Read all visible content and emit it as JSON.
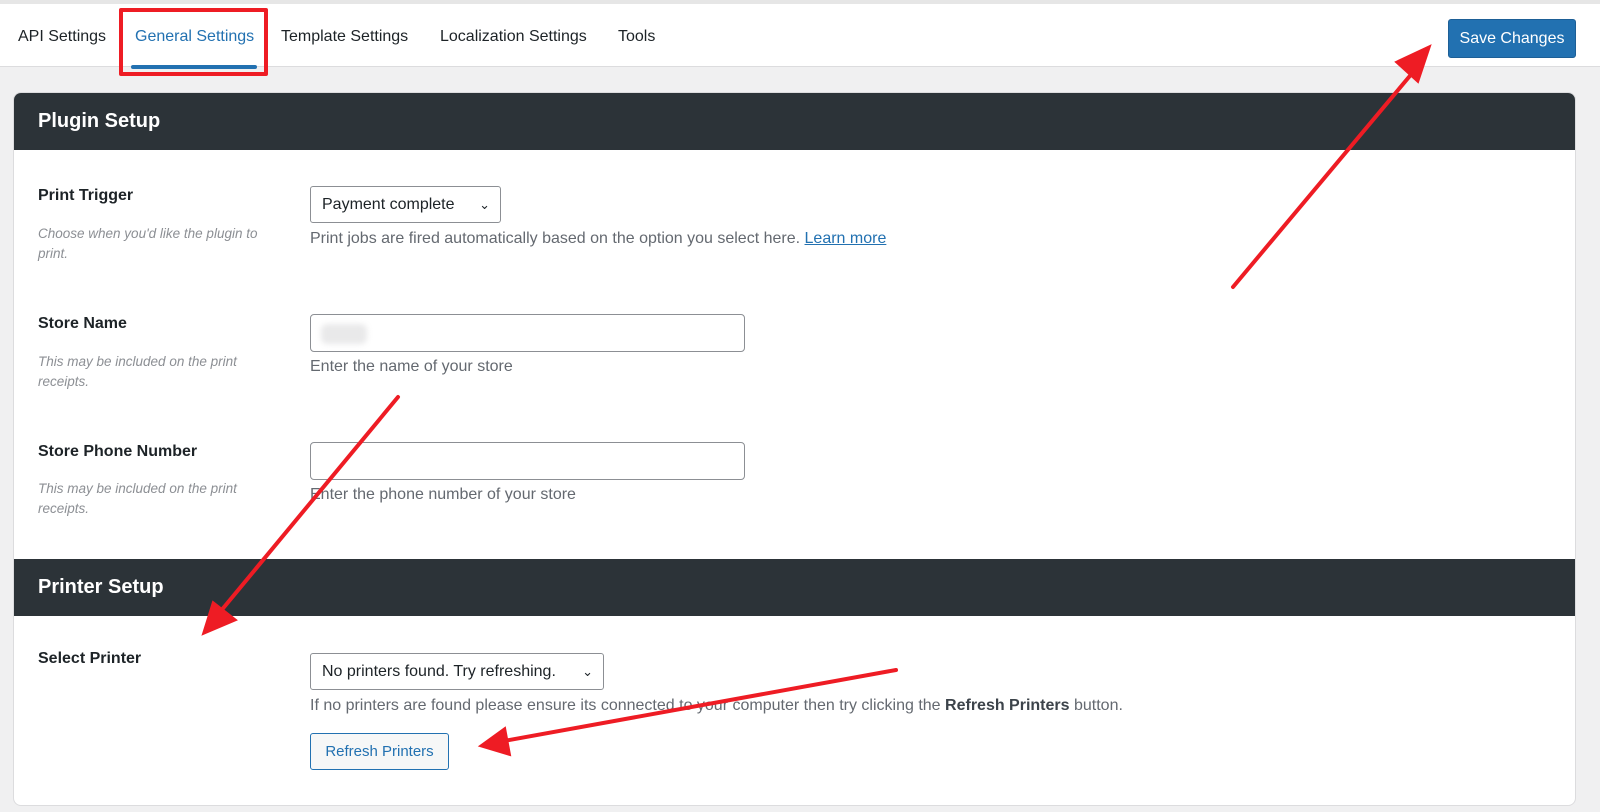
{
  "nav": {
    "tabs": [
      {
        "label": "API Settings"
      },
      {
        "label": "General Settings",
        "active": true
      },
      {
        "label": "Template Settings"
      },
      {
        "label": "Localization Settings"
      },
      {
        "label": "Tools"
      }
    ],
    "save_label": "Save Changes"
  },
  "plugin_setup": {
    "title": "Plugin Setup",
    "print_trigger": {
      "label": "Print Trigger",
      "help": "Choose when you'd like the plugin to print.",
      "selected": "Payment complete",
      "description": "Print jobs are fired automatically based on the option you select here.",
      "link": "Learn more"
    },
    "store_name": {
      "label": "Store Name",
      "help": "This may be included on the print receipts.",
      "value": "",
      "description": "Enter the name of your store"
    },
    "store_phone": {
      "label": "Store Phone Number",
      "help": "This may be included on the print receipts.",
      "value": "",
      "description": "Enter the phone number of your store"
    }
  },
  "printer_setup": {
    "title": "Printer Setup",
    "select_printer": {
      "label": "Select Printer",
      "selected": "No printers found. Try refreshing.",
      "description_before": "If no printers are found please ensure its connected to your computer then try clicking the",
      "description_bold": "Refresh Printers",
      "description_after": "button.",
      "refresh_label": "Refresh Printers"
    }
  },
  "colors": {
    "accent": "#2271b1",
    "header_bg": "#2c3338",
    "annotation": "#ee1c24"
  }
}
